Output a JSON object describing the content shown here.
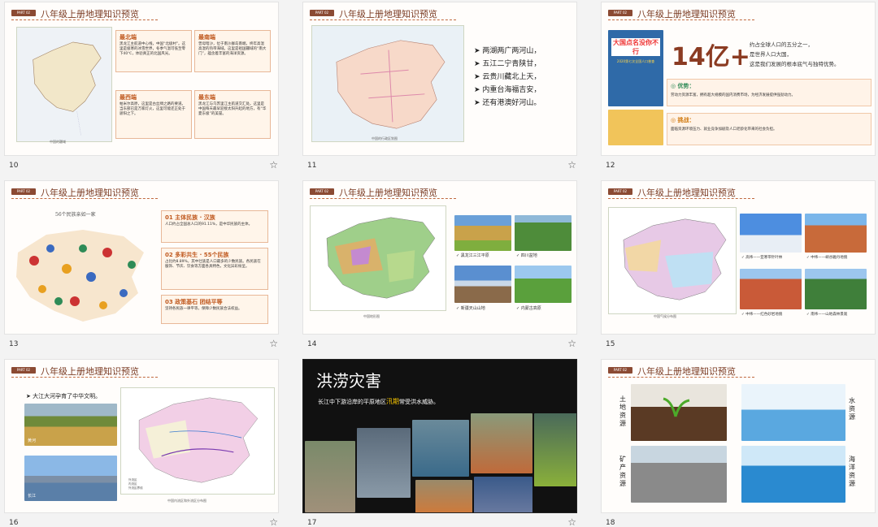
{
  "slides": {
    "s10": {
      "number": "10",
      "tag": "PART 02",
      "title": "八年级上册地理知识预览",
      "map_caption": "中国的疆域",
      "cards": [
        {
          "title": "最北端",
          "text": "黑龙江主航道中心线，中国“北极村”。这里是极寒的冰雪世界，冬季气温可低至零下40℃，体验真正的北国风光。"
        },
        {
          "title": "最南端",
          "text": "曾母暗沙，位于南沙群岛南端，终年高温高湿的热带海域。这里是祖国疆域的“南大门”，蕴含着丰富的海洋资源。"
        },
        {
          "title": "最西端",
          "text": "帕米尔高原，这里是古丝绸之路的要道。当东部已是万家灯火，这里可能还正处于骄阳之下。"
        },
        {
          "title": "最东端",
          "text": "黑龙江与乌苏里江主航道交汇处。这里是中国每天最早迎接太阳升起的地方，有“华夏东极”的美誉。"
        }
      ]
    },
    "s11": {
      "number": "11",
      "tag": "PART 02",
      "title": "八年级上册地理知识预览",
      "map_caption": "中国的行政区划图",
      "lines": [
        "两湖两广两河山，",
        "五江二宁青陕甘，",
        "云贵川藏北上天，",
        "内重台海福吉安，",
        "还有港澳好河山。"
      ]
    },
    "s12": {
      "number": "12",
      "tag": "PART 02",
      "title": "八年级上册地理知识预览",
      "big": "14亿+",
      "poster1": "大国点名没你不行",
      "poster1_sub": "2020第七次全国人口普查",
      "desc": [
        "约占全球人口的五分之一，",
        "是世界人口大国，",
        "这是我们发展的根本底气与独特优势。"
      ],
      "adv_title": "优势：",
      "adv_text": "劳动力资源丰富，拥有超大规模的国内消费市场，为经济发展提供强劲动力。",
      "chal_title": "挑战：",
      "chal_text": "面临资源环境压力、就业竞争加剧及人口老龄化带来的社会负担。"
    },
    "s13": {
      "number": "13",
      "tag": "PART 02",
      "title": "八年级上册地理知识预览",
      "map_title": "56个民族亲如一家",
      "items": [
        {
          "title": "01 主体民族 · 汉族",
          "text": "人口约占全国总人口的91.11%，是中华民族的主体。"
        },
        {
          "title": "02 多彩共生 · 55个民族",
          "text": "占比约8.89%，其中壮族是人口最多的少数民族。各民族在服饰、节庆、饮食等方面各具特色，文化异彩纷呈。"
        },
        {
          "title": "03 政策基石 团结平等",
          "text": "坚持各民族一律平等，保障少数民族合法权益。"
        }
      ]
    },
    "s14": {
      "number": "14",
      "tag": "PART 02",
      "title": "八年级上册地理知识预览",
      "map_caption": "中国地形图",
      "photos": [
        "黑龙江三江平原",
        "四川盆地",
        "新疆天山山地",
        "内蒙古高原"
      ]
    },
    "s15": {
      "number": "15",
      "tag": "PART 02",
      "title": "八年级上册地理知识预览",
      "map_caption": "中国气候分布图",
      "photos": [
        "高纬——亚寒带针叶林",
        "中纬——峡谷雅丹地貌",
        "中纬——红色砂岩地貌",
        "南纬——山地森林景观"
      ]
    },
    "s16": {
      "number": "16",
      "tag": "PART 02",
      "title": "八年级上册地理知识预览",
      "lead": "大江大河孕育了中华文明。",
      "photo1": "黄河",
      "photo2": "长江",
      "map_caption": "中国内流区和外流区分布图",
      "legend": [
        "外流区",
        "内流区",
        "外流区界线"
      ]
    },
    "s17": {
      "number": "17",
      "title": "洪涝灾害",
      "sub_pre": "长江中下游沿岸的平原地区",
      "sub_hl": "汛期",
      "sub_post": "常受洪水威胁。"
    },
    "s18": {
      "number": "18",
      "tag": "PART 02",
      "title": "八年级上册地理知识预览",
      "labels": [
        "土地资源",
        "水资源",
        "矿产资源",
        "海洋资源"
      ]
    }
  },
  "colors": {
    "accent": "#8b4a33",
    "highlight": "#f5c400",
    "title": "#7a3a22"
  },
  "icons": {
    "star": "star-icon",
    "arrow": "arrow-bullet-icon"
  }
}
